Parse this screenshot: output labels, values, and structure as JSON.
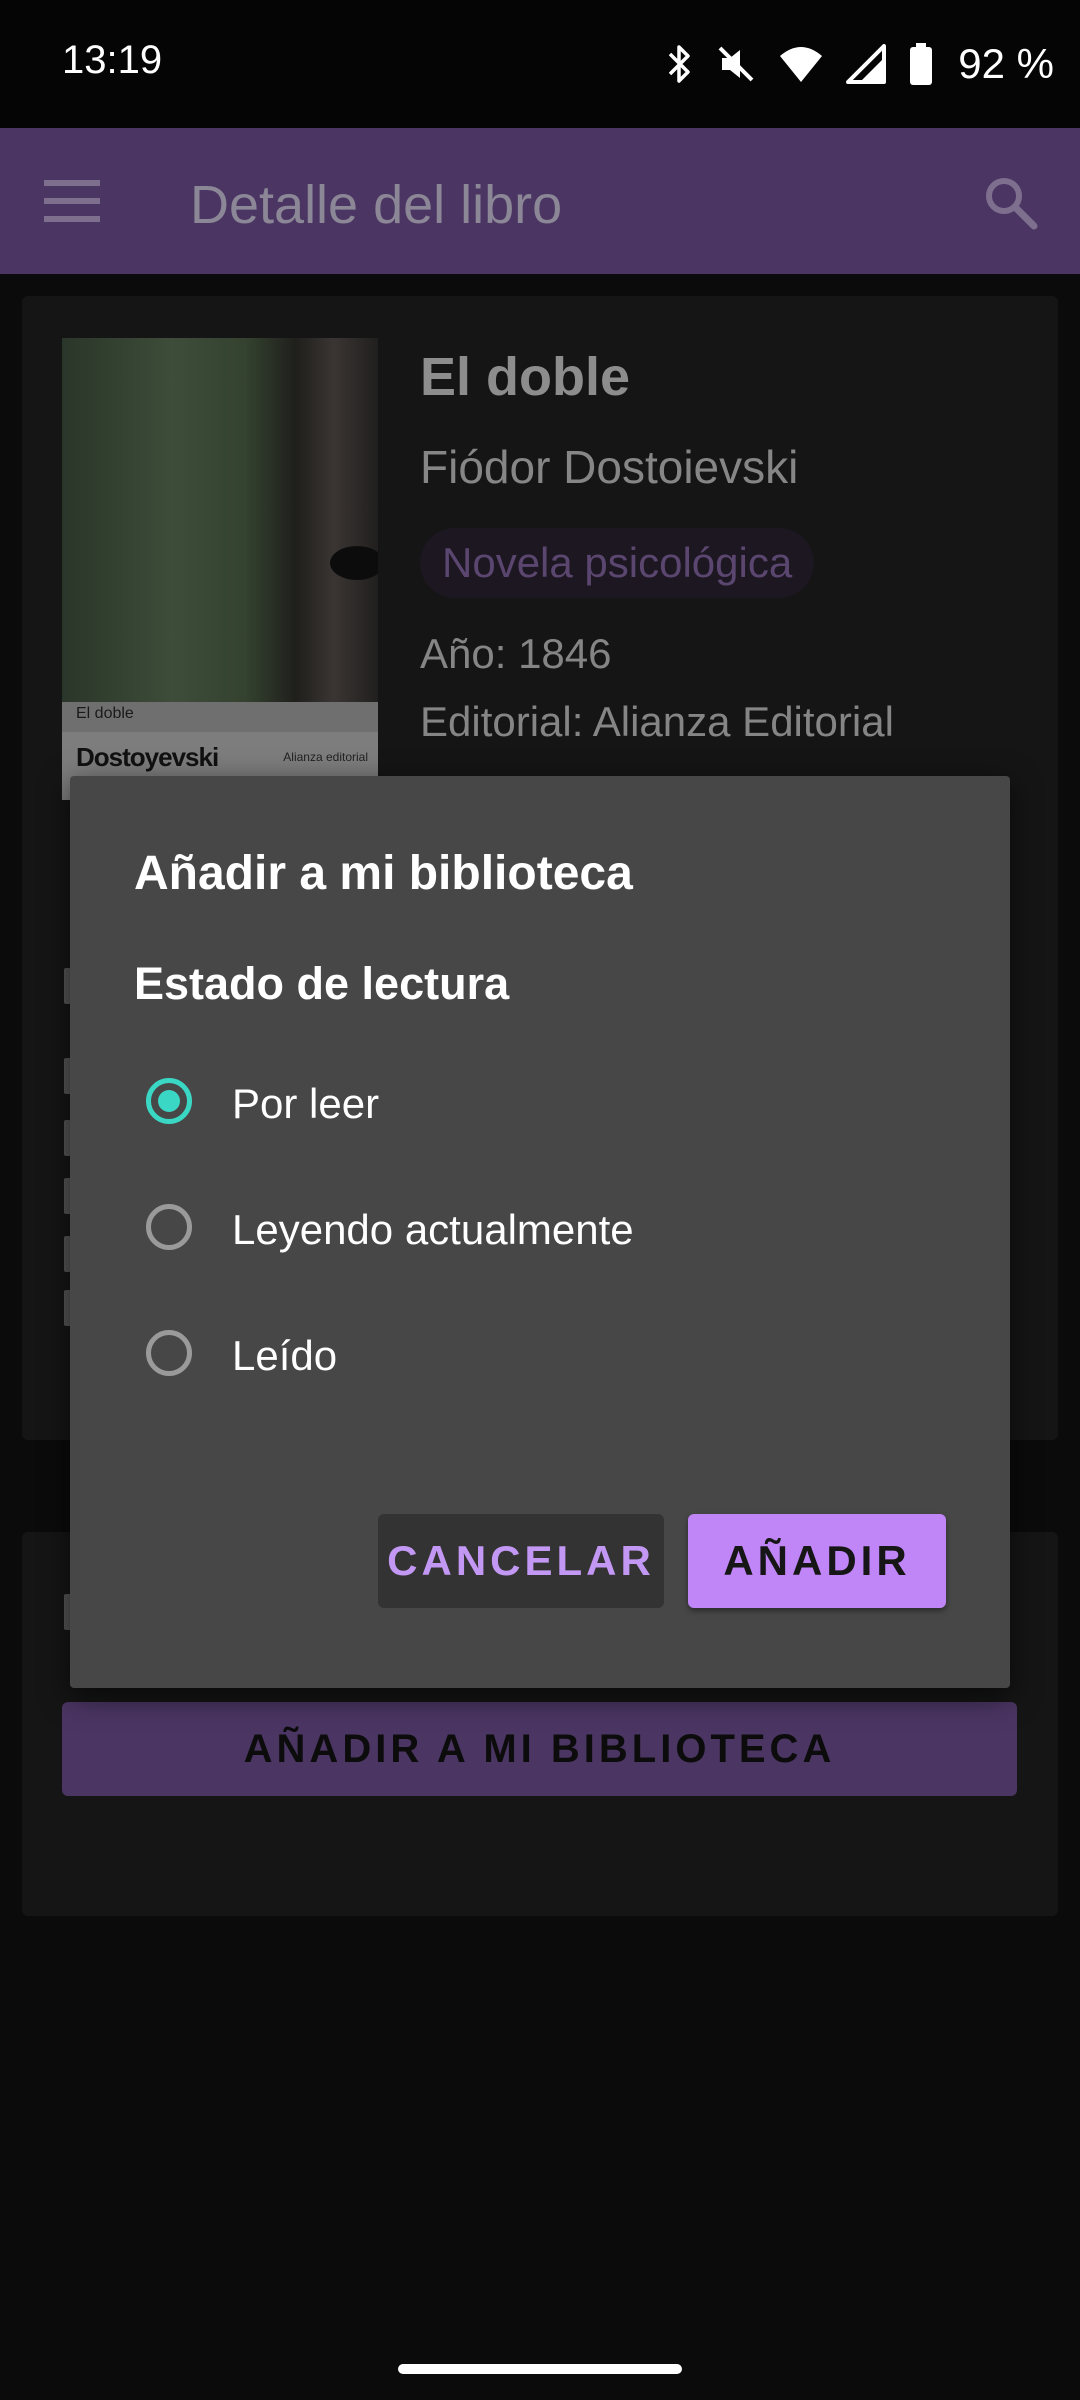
{
  "status_bar": {
    "time": "13:19",
    "battery": "92 %",
    "icons": [
      "bluetooth-icon",
      "vibrate-off-icon",
      "wifi-icon",
      "signal-icon",
      "battery-icon"
    ]
  },
  "app_bar": {
    "title": "Detalle del libro",
    "menu_icon": "menu-icon",
    "search_icon": "search-icon",
    "background": "#4b3563"
  },
  "book": {
    "title": "El doble",
    "author": "Fiódor Dostoievski",
    "genre": "Novela psicológica",
    "year": "Año: 1846",
    "publisher": "Editorial: Alianza Editorial",
    "cover": {
      "small_title": "El doble",
      "author": "Dostoyevski",
      "publisher": "Alianza editorial"
    }
  },
  "background_button": {
    "label": "AÑADIR A MI BIBLIOTECA"
  },
  "dialog": {
    "title": "Añadir a mi biblioteca",
    "subtitle": "Estado de lectura",
    "options": [
      {
        "label": "Por leer",
        "selected": true
      },
      {
        "label": "Leyendo actualmente",
        "selected": false
      },
      {
        "label": "Leído",
        "selected": false
      }
    ],
    "cancel_label": "CANCELAR",
    "confirm_label": "AÑADIR",
    "accent_color": "#3ad8c4",
    "button_color": "#c085f7"
  }
}
